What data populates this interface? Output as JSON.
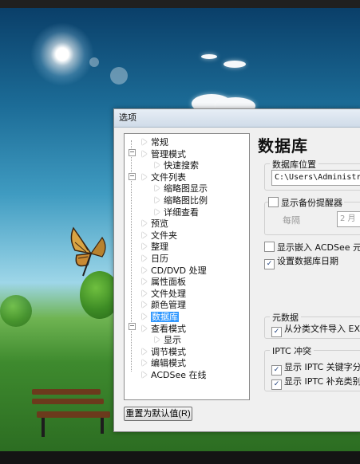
{
  "dialog": {
    "title": "选项"
  },
  "tree": [
    {
      "label": "常规",
      "level": 0,
      "selected": false
    },
    {
      "label": "管理模式",
      "level": 0,
      "selected": false
    },
    {
      "label": "快速搜索",
      "level": 1,
      "selected": false
    },
    {
      "label": "文件列表",
      "level": 0,
      "selected": false
    },
    {
      "label": "缩略图显示",
      "level": 1,
      "selected": false
    },
    {
      "label": "缩略图比例",
      "level": 1,
      "selected": false
    },
    {
      "label": "详细查看",
      "level": 1,
      "selected": false
    },
    {
      "label": "预览",
      "level": 0,
      "selected": false
    },
    {
      "label": "文件夹",
      "level": 0,
      "selected": false
    },
    {
      "label": "整理",
      "level": 0,
      "selected": false
    },
    {
      "label": "日历",
      "level": 0,
      "selected": false
    },
    {
      "label": "CD/DVD 处理",
      "level": 0,
      "selected": false
    },
    {
      "label": "属性面板",
      "level": 0,
      "selected": false
    },
    {
      "label": "文件处理",
      "level": 0,
      "selected": false
    },
    {
      "label": "颜色管理",
      "level": 0,
      "selected": false
    },
    {
      "label": "数据库",
      "level": 0,
      "selected": true
    },
    {
      "label": "查看模式",
      "level": 0,
      "selected": false
    },
    {
      "label": "显示",
      "level": 1,
      "selected": false
    },
    {
      "label": "调节模式",
      "level": 0,
      "selected": false
    },
    {
      "label": "编辑模式",
      "level": 0,
      "selected": false
    },
    {
      "label": "ACDSee 在线",
      "level": 0,
      "selected": false
    }
  ],
  "reset_button": "重置为默认值(R)",
  "panel": {
    "heading": "数据库",
    "location_group": "数据库位置",
    "location_value": "C:\\Users\\Administrat",
    "backup_checkbox": "显示备份提醒器",
    "interval_label": "每隔",
    "interval_value": "2 月",
    "embed_checkbox": "显示嵌入 ACDSee 元数",
    "date_checkbox": "设置数据库日期",
    "metadata_group": "元数据",
    "exif_checkbox": "从分类文件导入 EXI",
    "iptc_group": "IPTC 冲突",
    "iptc_keywords_checkbox": "显示 IPTC 关键字分",
    "iptc_category_checkbox": "显示 IPTC 补充类别"
  },
  "checks": {
    "backup": false,
    "embed": false,
    "date": true,
    "exif": true,
    "iptc_keywords": true,
    "iptc_category": true
  },
  "colors": {
    "selection": "#3399ff",
    "dialog_bg": "#f0f0f0"
  }
}
